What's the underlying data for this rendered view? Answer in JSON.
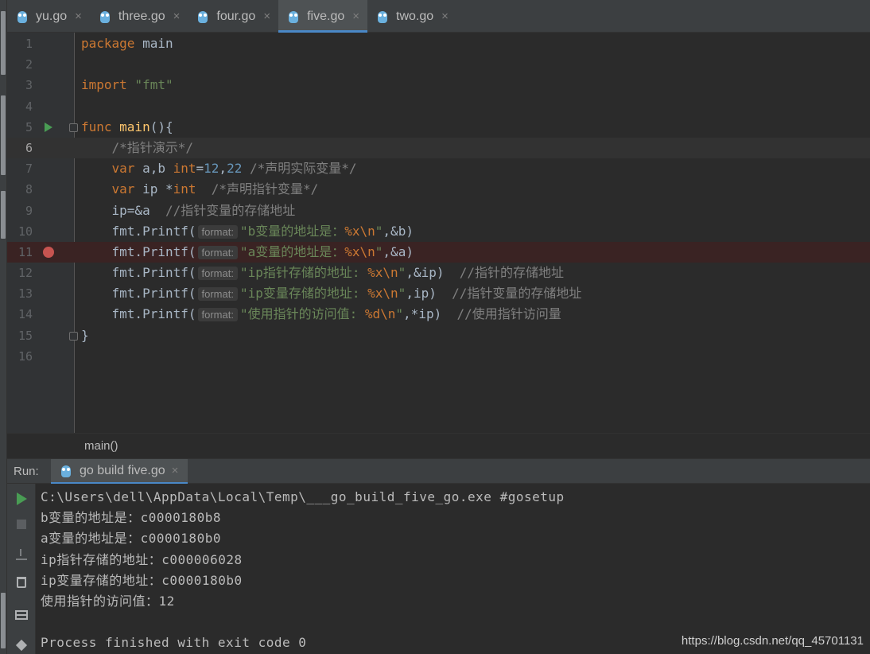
{
  "tabs": [
    {
      "label": "yu.go",
      "active": false
    },
    {
      "label": "three.go",
      "active": false
    },
    {
      "label": "four.go",
      "active": false
    },
    {
      "label": "five.go",
      "active": true
    },
    {
      "label": "two.go",
      "active": false
    }
  ],
  "editor": {
    "line_numbers": [
      "1",
      "2",
      "3",
      "4",
      "5",
      "6",
      "7",
      "8",
      "9",
      "10",
      "11",
      "12",
      "13",
      "14",
      "15",
      "16"
    ],
    "code": {
      "l1_kw": "package",
      "l1_id": " main",
      "l3_kw": "import",
      "l3_str": " \"fmt\"",
      "l5_kw": "func",
      "l5_fn": " main",
      "l5_rest": "(){",
      "l6_cm": "/*指针演示*/",
      "l7_kw": "var",
      "l7_id": " a,b ",
      "l7_ty": "int",
      "l7_eq": "=",
      "l7_n1": "12",
      "l7_comma": ",",
      "l7_n2": "22",
      "l7_cm": " /*声明实际变量*/",
      "l8_kw": "var",
      "l8_id": " ip *",
      "l8_ty": "int",
      "l8_cm": "  /*声明指针变量*/",
      "l9_id": "ip=&a",
      "l9_cm": "  //指针变量的存储地址",
      "l10_call": "fmt.Printf(",
      "l10_s1": "\"b变量的地址是：",
      "l10_esc": "%x\\n",
      "l10_s2": "\"",
      "l10_rest": ",&b)",
      "l11_call": "fmt.Printf(",
      "l11_s1": "\"a变量的地址是：",
      "l11_esc": "%x\\n",
      "l11_s2": "\"",
      "l11_rest": ",&a)",
      "l12_call": "fmt.Printf(",
      "l12_s1": "\"ip指针存储的地址: ",
      "l12_esc": "%x\\n",
      "l12_s2": "\"",
      "l12_rest": ",&ip)",
      "l12_cm": "  //指针的存储地址",
      "l13_call": "fmt.Printf(",
      "l13_s1": "\"ip变量存储的地址: ",
      "l13_esc": "%x\\n",
      "l13_s2": "\"",
      "l13_rest": ",ip)",
      "l13_cm": "  //指针变量的存储地址",
      "l14_call": "fmt.Printf(",
      "l14_s1": "\"使用指针的访问值: ",
      "l14_esc": "%d\\n",
      "l14_s2": "\"",
      "l14_rest": ",*ip)",
      "l14_cm": "  //使用指针访问量",
      "l15": "}"
    },
    "param_hint": "format:",
    "breadcrumb": "main()"
  },
  "run_panel": {
    "label": "Run:",
    "tab_label": "go build five.go",
    "output": [
      "C:\\Users\\dell\\AppData\\Local\\Temp\\___go_build_five_go.exe #gosetup",
      "b变量的地址是：c0000180b8",
      "a变量的地址是：c0000180b0",
      "ip指针存储的地址：c000006028",
      "ip变量存储的地址：c0000180b0",
      "使用指针的访问值：12",
      "",
      "Process finished with exit code 0"
    ]
  },
  "watermark": "https://blog.csdn.net/qq_45701131",
  "colors": {
    "keyword": "#cc7832",
    "function": "#ffc66d",
    "string": "#6a8759",
    "number": "#6897bb",
    "comment": "#808080",
    "breakpoint": "#c75450",
    "run_green": "#499c54",
    "tab_accent": "#4a88c7"
  }
}
